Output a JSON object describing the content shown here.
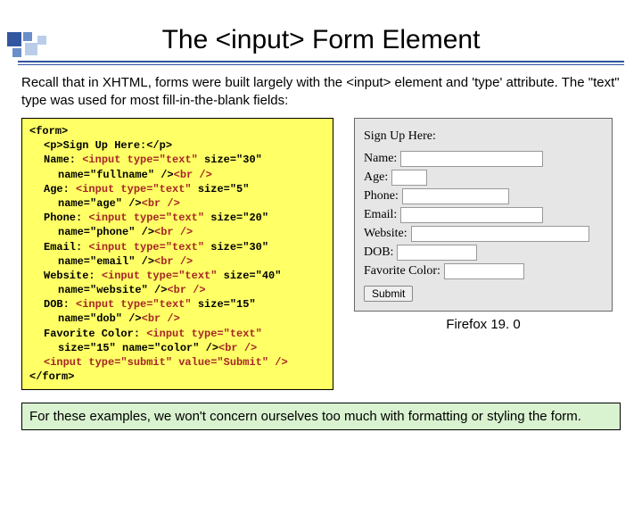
{
  "title": "The <input> Form Element",
  "intro": "Recall that in XHTML, forms were built largely with the <input> element and 'type' attribute.  The \"text\" type was used for most fill-in-the-blank fields:",
  "code": {
    "l0": "<form>",
    "l1": "<p>Sign Up Here:</p>",
    "l2a": "Name: ",
    "l2b": "<input type=\"text\"",
    "l2c": " size=\"30\"",
    "l3a": "name=\"fullname\" />",
    "l3b": "<br />",
    "l4a": "Age: ",
    "l4b": "<input type=\"text\"",
    "l4c": " size=\"5\"",
    "l5a": "name=\"age\" />",
    "l5b": "<br />",
    "l6a": "Phone: ",
    "l6b": "<input type=\"text\"",
    "l6c": " size=\"20\"",
    "l7a": "name=\"phone\" />",
    "l7b": "<br />",
    "l8a": "Email: ",
    "l8b": "<input type=\"text\"",
    "l8c": " size=\"30\"",
    "l9a": "name=\"email\" />",
    "l9b": "<br />",
    "l10a": "Website: ",
    "l10b": "<input type=\"text\"",
    "l10c": " size=\"40\"",
    "l11a": "name=\"website\" />",
    "l11b": "<br />",
    "l12a": "DOB: ",
    "l12b": "<input type=\"text\"",
    "l12c": " size=\"15\"",
    "l13a": "name=\"dob\" />",
    "l13b": "<br />",
    "l14a": "Favorite Color: ",
    "l14b": "<input type=\"text\"",
    "l15a": "size=\"15\" name=\"color\" />",
    "l15b": "<br />",
    "l16": "<input type=\"submit\" value=\"Submit\" />",
    "l17": "</form>"
  },
  "preview": {
    "heading": "Sign Up Here:",
    "labels": {
      "name": "Name:",
      "age": "Age:",
      "phone": "Phone:",
      "email": "Email:",
      "website": "Website:",
      "dob": "DOB:",
      "color": "Favorite Color:"
    },
    "submit": "Submit"
  },
  "caption": "Firefox 19. 0",
  "note": "For these examples, we won't concern ourselves too much with formatting or styling the form.",
  "deco_colors": {
    "dark": "#3256a0",
    "mid": "#6a8fc9",
    "light": "#b9cdea"
  }
}
